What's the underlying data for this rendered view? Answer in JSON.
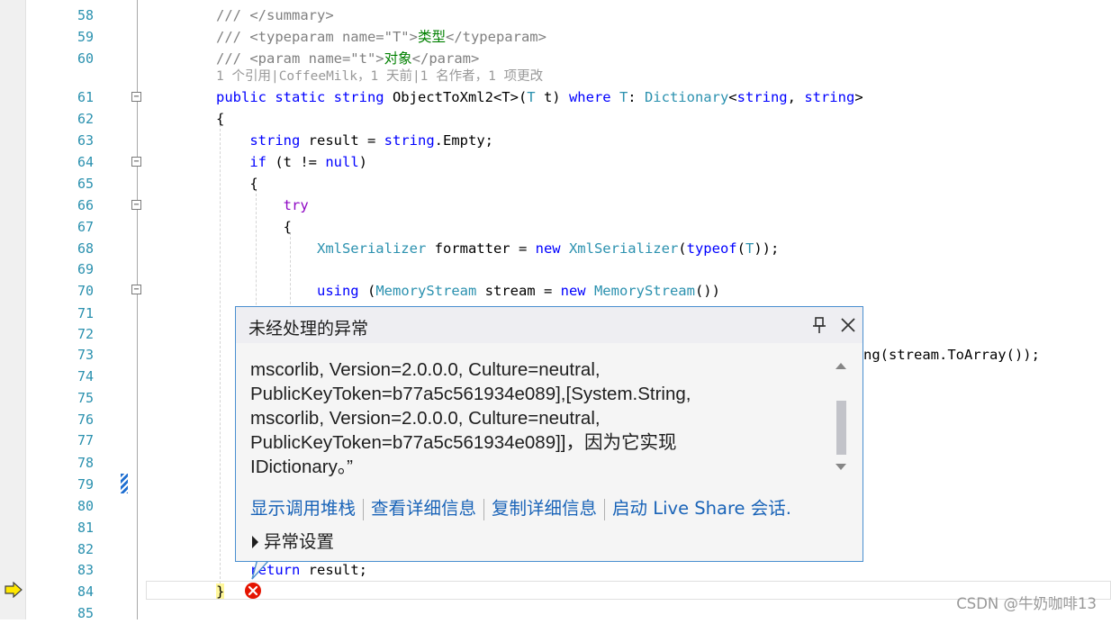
{
  "editor": {
    "codelens": "1 个引用|CoffeeMilk，1 天前|1 名作者，1 项更改",
    "lines": [
      {
        "n": "58",
        "segs": [
          {
            "t": "/// </summary>",
            "c": "c"
          }
        ]
      },
      {
        "n": "59",
        "segs": [
          {
            "t": "/// <typeparam name=\"T\">",
            "c": "c"
          },
          {
            "t": "类型",
            "c": "g"
          },
          {
            "t": "</typeparam>",
            "c": "c"
          }
        ]
      },
      {
        "n": "60",
        "segs": [
          {
            "t": "/// <param name=\"t\">",
            "c": "c"
          },
          {
            "t": "对象",
            "c": "g"
          },
          {
            "t": "</param>",
            "c": "c"
          }
        ]
      },
      {
        "n": "61",
        "segs": [
          {
            "t": "public static string ",
            "c": "k"
          },
          {
            "t": "ObjectToXml2<T>(",
            "c": ""
          },
          {
            "t": "T",
            "c": "t"
          },
          {
            "t": " t) ",
            "c": ""
          },
          {
            "t": "where ",
            "c": "k"
          },
          {
            "t": "T",
            "c": "t"
          },
          {
            "t": ": ",
            "c": ""
          },
          {
            "t": "Dictionary",
            "c": "t"
          },
          {
            "t": "<",
            "c": ""
          },
          {
            "t": "string",
            "c": "k"
          },
          {
            "t": ", ",
            "c": ""
          },
          {
            "t": "string",
            "c": "k"
          },
          {
            "t": ">",
            "c": ""
          }
        ]
      },
      {
        "n": "62",
        "segs": [
          {
            "t": "{",
            "c": ""
          }
        ]
      },
      {
        "n": "63",
        "segs": [
          {
            "t": "    ",
            "c": ""
          },
          {
            "t": "string",
            "c": "k"
          },
          {
            "t": " result = ",
            "c": ""
          },
          {
            "t": "string",
            "c": "k"
          },
          {
            "t": ".Empty;",
            "c": ""
          }
        ]
      },
      {
        "n": "64",
        "segs": [
          {
            "t": "    ",
            "c": ""
          },
          {
            "t": "if",
            "c": "k"
          },
          {
            "t": " (t != ",
            "c": ""
          },
          {
            "t": "null",
            "c": "k"
          },
          {
            "t": ")",
            "c": ""
          }
        ]
      },
      {
        "n": "65",
        "segs": [
          {
            "t": "    {",
            "c": ""
          }
        ]
      },
      {
        "n": "66",
        "segs": [
          {
            "t": "        ",
            "c": ""
          },
          {
            "t": "try",
            "c": "p"
          }
        ]
      },
      {
        "n": "67",
        "segs": [
          {
            "t": "        {",
            "c": ""
          }
        ]
      },
      {
        "n": "68",
        "segs": [
          {
            "t": "            ",
            "c": ""
          },
          {
            "t": "XmlSerializer",
            "c": "t"
          },
          {
            "t": " formatter = ",
            "c": ""
          },
          {
            "t": "new ",
            "c": "k"
          },
          {
            "t": "XmlSerializer",
            "c": "t"
          },
          {
            "t": "(",
            "c": ""
          },
          {
            "t": "typeof",
            "c": "k"
          },
          {
            "t": "(",
            "c": ""
          },
          {
            "t": "T",
            "c": "t"
          },
          {
            "t": "));",
            "c": ""
          }
        ]
      },
      {
        "n": "69",
        "segs": []
      },
      {
        "n": "70",
        "segs": [
          {
            "t": "            ",
            "c": ""
          },
          {
            "t": "using",
            "c": "k"
          },
          {
            "t": " (",
            "c": ""
          },
          {
            "t": "MemoryStream",
            "c": "t"
          },
          {
            "t": " stream = ",
            "c": ""
          },
          {
            "t": "new ",
            "c": "k"
          },
          {
            "t": "MemoryStream",
            "c": "t"
          },
          {
            "t": "())",
            "c": ""
          }
        ]
      },
      {
        "n": "71",
        "segs": []
      },
      {
        "n": "72",
        "segs": []
      },
      {
        "n": "73",
        "segs": []
      },
      {
        "n": "74",
        "segs": []
      },
      {
        "n": "75",
        "segs": []
      },
      {
        "n": "76",
        "segs": []
      },
      {
        "n": "77",
        "segs": []
      },
      {
        "n": "78",
        "segs": []
      },
      {
        "n": "79",
        "segs": []
      },
      {
        "n": "80",
        "segs": []
      },
      {
        "n": "81",
        "segs": []
      },
      {
        "n": "82",
        "segs": []
      },
      {
        "n": "83",
        "segs": [
          {
            "t": "    ",
            "c": ""
          },
          {
            "t": "return",
            "c": "k"
          },
          {
            "t": " result;",
            "c": ""
          }
        ]
      },
      {
        "n": "84",
        "segs": [
          {
            "t": "}",
            "c": "b"
          }
        ]
      },
      {
        "n": "85",
        "segs": []
      }
    ],
    "partial_line_73": "ng(stream.ToArray());"
  },
  "popup": {
    "title": "未经处理的异常",
    "body_lines": [
      "mscorlib, Version=2.0.0.0, Culture=neutral,",
      "PublicKeyToken=b77a5c561934e089],[System.String,",
      "mscorlib, Version=2.0.0.0, Culture=neutral,",
      "PublicKeyToken=b77a5c561934e089]]，因为它实现",
      "IDictionary。”"
    ],
    "links": {
      "call_stack": "显示调用堆栈",
      "view_details": "查看详细信息",
      "copy_details": "复制详细信息",
      "live_share": "启动 Live Share 会话."
    },
    "exception_settings": "异常设置"
  },
  "watermark": "CSDN @牛奶咖啡13",
  "colors": {
    "comment": "#808080",
    "keyword": "#0000ff",
    "type": "#2b91af",
    "control": "#8f08c4",
    "link": "#1a64b8",
    "popup_border": "#4a8fd0"
  }
}
